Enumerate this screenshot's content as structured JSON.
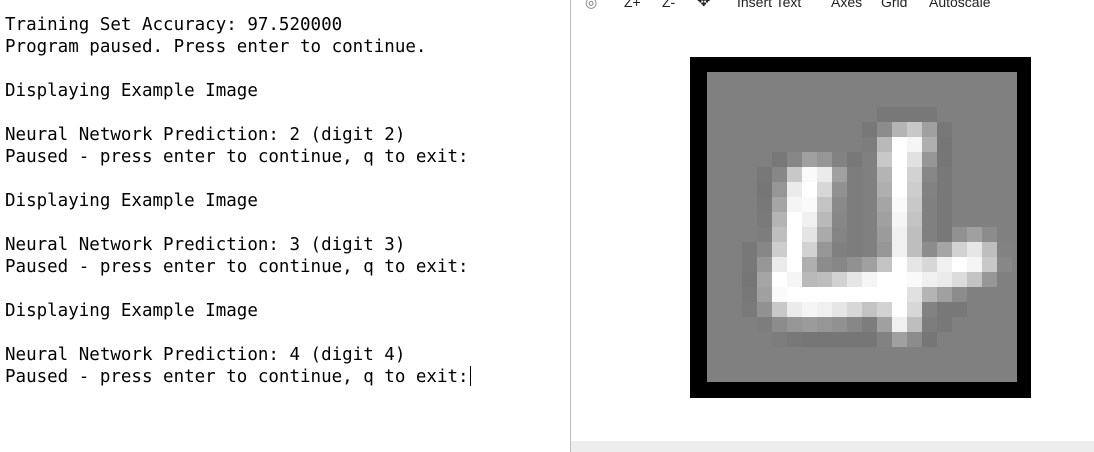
{
  "terminal": {
    "lines": [
      "Training Set Accuracy: 97.520000",
      "Program paused. Press enter to continue.",
      "",
      "Displaying Example Image",
      "",
      "Neural Network Prediction: 2 (digit 2)",
      "Paused - press enter to continue, q to exit:",
      "",
      "Displaying Example Image",
      "",
      "Neural Network Prediction: 3 (digit 3)",
      "Paused - press enter to continue, q to exit:",
      "",
      "Displaying Example Image",
      "",
      "Neural Network Prediction: 4 (digit 4)",
      "Paused - press enter to continue, q to exit:"
    ]
  },
  "figure": {
    "toolbar": {
      "rotate_icon": "rotate-icon",
      "zoom_in_label": "Z+",
      "zoom_out_label": "Z-",
      "pan_icon": "pan-icon",
      "insert_text_label": "Insert Text",
      "axes_label": "Axes",
      "grid_label": "Grid",
      "autoscale_label": "Autoscale"
    },
    "image": {
      "rows": 20,
      "cols": 20,
      "background_gray": 128,
      "pixels": [
        [
          128,
          128,
          128,
          128,
          128,
          128,
          128,
          128,
          128,
          128,
          128,
          128,
          128,
          128,
          128,
          128,
          128,
          128,
          128,
          128
        ],
        [
          128,
          128,
          128,
          128,
          128,
          128,
          128,
          128,
          128,
          128,
          128,
          128,
          128,
          128,
          128,
          128,
          128,
          128,
          128,
          128
        ],
        [
          128,
          128,
          128,
          128,
          128,
          128,
          128,
          128,
          128,
          128,
          128,
          120,
          120,
          120,
          120,
          128,
          128,
          128,
          128,
          128
        ],
        [
          128,
          128,
          128,
          128,
          128,
          128,
          128,
          128,
          128,
          128,
          120,
          140,
          180,
          200,
          160,
          120,
          128,
          128,
          128,
          128
        ],
        [
          128,
          128,
          128,
          128,
          128,
          128,
          128,
          128,
          128,
          128,
          125,
          185,
          255,
          245,
          175,
          118,
          128,
          128,
          128,
          128
        ],
        [
          128,
          128,
          128,
          128,
          120,
          135,
          160,
          150,
          130,
          120,
          128,
          200,
          255,
          225,
          150,
          118,
          128,
          128,
          128,
          128
        ],
        [
          128,
          128,
          128,
          120,
          135,
          200,
          250,
          235,
          160,
          125,
          128,
          180,
          255,
          210,
          135,
          120,
          128,
          128,
          128,
          128
        ],
        [
          128,
          128,
          128,
          118,
          150,
          235,
          255,
          215,
          145,
          125,
          128,
          175,
          255,
          205,
          130,
          120,
          128,
          128,
          128,
          128
        ],
        [
          128,
          128,
          128,
          120,
          165,
          245,
          250,
          195,
          138,
          125,
          128,
          165,
          250,
          200,
          128,
          120,
          128,
          128,
          128,
          128
        ],
        [
          128,
          128,
          128,
          122,
          180,
          255,
          240,
          185,
          135,
          125,
          128,
          160,
          245,
          195,
          128,
          120,
          128,
          128,
          128,
          128
        ],
        [
          128,
          128,
          128,
          125,
          190,
          255,
          228,
          170,
          132,
          125,
          128,
          155,
          240,
          190,
          128,
          120,
          145,
          160,
          140,
          128
        ],
        [
          128,
          128,
          120,
          135,
          205,
          255,
          210,
          150,
          128,
          125,
          128,
          150,
          240,
          190,
          140,
          165,
          210,
          230,
          190,
          130
        ],
        [
          128,
          128,
          120,
          150,
          235,
          255,
          175,
          140,
          135,
          145,
          160,
          195,
          255,
          230,
          215,
          240,
          255,
          245,
          200,
          135
        ],
        [
          128,
          128,
          118,
          165,
          255,
          245,
          185,
          190,
          210,
          230,
          245,
          255,
          255,
          250,
          240,
          235,
          220,
          195,
          150,
          128
        ],
        [
          128,
          128,
          120,
          160,
          250,
          255,
          255,
          255,
          255,
          255,
          255,
          255,
          255,
          225,
          180,
          160,
          140,
          128,
          128,
          128
        ],
        [
          128,
          128,
          122,
          145,
          200,
          235,
          245,
          240,
          230,
          215,
          195,
          210,
          255,
          215,
          130,
          120,
          120,
          128,
          128,
          128
        ],
        [
          128,
          128,
          128,
          125,
          140,
          150,
          155,
          150,
          145,
          135,
          125,
          160,
          240,
          190,
          125,
          120,
          128,
          128,
          128,
          128
        ],
        [
          128,
          128,
          128,
          128,
          125,
          120,
          118,
          118,
          118,
          118,
          118,
          130,
          160,
          140,
          118,
          128,
          128,
          128,
          128,
          128
        ],
        [
          128,
          128,
          128,
          128,
          128,
          128,
          128,
          128,
          128,
          128,
          128,
          128,
          128,
          128,
          128,
          128,
          128,
          128,
          128,
          128
        ],
        [
          128,
          128,
          128,
          128,
          128,
          128,
          128,
          128,
          128,
          128,
          128,
          128,
          128,
          128,
          128,
          128,
          128,
          128,
          128,
          128
        ]
      ]
    }
  }
}
